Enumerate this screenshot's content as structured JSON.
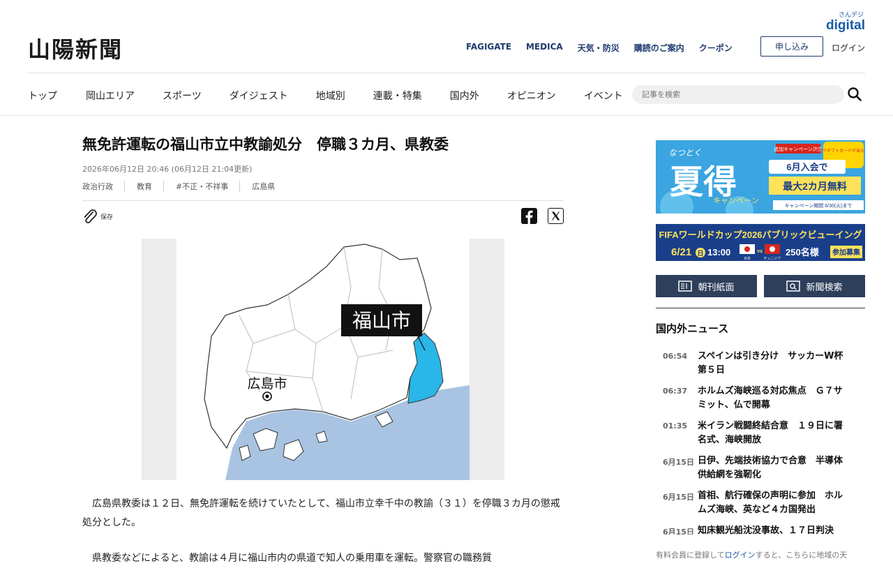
{
  "header": {
    "logo": "山陽新聞",
    "digital_small": "さんデジ",
    "digital_big": "digital",
    "top_links": [
      "FAGIGATE",
      "MEDICA",
      "天気・防災",
      "購読のご案内",
      "クーポン"
    ],
    "apply_label": "申し込み",
    "login_label": "ログイン",
    "nav": [
      "トップ",
      "岡山エリア",
      "スポーツ",
      "ダイジェスト",
      "地域別",
      "連載・特集",
      "国内外",
      "オピニオン",
      "イベント"
    ],
    "search_placeholder": "記事を検索"
  },
  "article": {
    "title": "無免許運転の福山市立中教諭処分　停職３カ月、県教委",
    "date": "2026年06月12日 20:46 (06月12日 21:04更新)",
    "tags": [
      "政治行政",
      "教育",
      "#不正・不祥事",
      "広島県"
    ],
    "save_label": "保存",
    "map_label_fukuyama": "福山市",
    "map_label_hiroshima": "広島市",
    "paragraphs": [
      "広島県教委は１２日、無免許運転を続けていたとして、福山市立幸千中の教諭（３１）を停職３カ月の懲戒処分とした。",
      "県教委などによると、教諭は４月に福山市内の県道で知人の乗用車を運転。警察官の職務質"
    ]
  },
  "sidebar": {
    "banner1": {
      "tagline": "なつとく",
      "main": "夏得",
      "sub": "キャンペーン",
      "badge": "追加キャンペーン決定",
      "gift": "抽選でギフトカードが当たる！",
      "offer1": "6月入会で",
      "offer2": "最大2カ月無料",
      "period": "キャンペーン期間 6/30(火)まで"
    },
    "banner2": {
      "title": "FIFAワールドカップ2026パブリックビューイング",
      "date": "6/21",
      "day": "日",
      "time": "13:00",
      "team1": "日本",
      "vs": "vs",
      "team2": "チュニジア",
      "capacity": "250名様",
      "recruit": "参加募集"
    },
    "btn_edition": "朝刊紙面",
    "btn_search": "新聞検索",
    "news_heading": "国内外ニュース",
    "news": [
      {
        "time": "06:54",
        "headline": "スペインは引き分け　サッカーW杯第５日"
      },
      {
        "time": "06:37",
        "headline": "ホルムズ海峡巡る対応焦点　Ｇ７サミット、仏で開幕"
      },
      {
        "time": "01:35",
        "headline": "米イラン戦闘終結合意　１９日に署名式、海峡開放"
      },
      {
        "time": "6月15日",
        "headline": "日伊、先端技術協力で合意　半導体供給網を強靭化"
      },
      {
        "time": "6月15日",
        "headline": "首相、航行確保の声明に参加　ホルムズ海峡、英など４カ国発出"
      },
      {
        "time": "6月15日",
        "headline": "知床観光船沈没事故、１７日判決"
      }
    ],
    "footer_pre": "有料会員に登録して",
    "footer_link": "ログイン",
    "footer_post": "すると、こちらに地域の天"
  }
}
